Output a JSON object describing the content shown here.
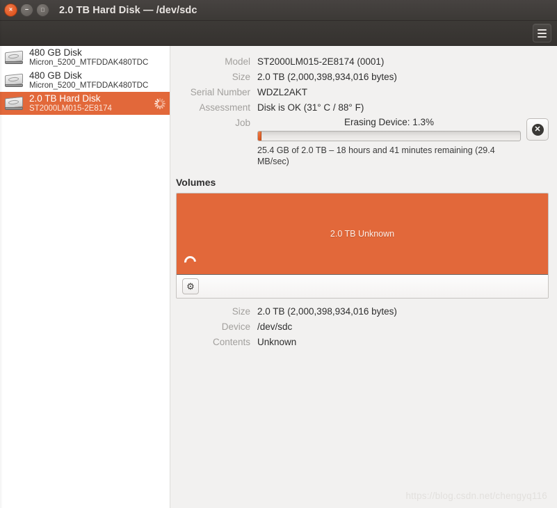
{
  "window": {
    "title": "2.0 TB Hard Disk — /dev/sdc",
    "close_glyph": "×",
    "minimize_glyph": "−",
    "maximize_glyph": "□"
  },
  "toolbar": {
    "menu_button_name": "Main Menu"
  },
  "sidebar": {
    "disks": [
      {
        "title": "480 GB Disk",
        "subtitle": "Micron_5200_MTFDDAK480TDC",
        "selected": false,
        "busy": false
      },
      {
        "title": "480 GB Disk",
        "subtitle": "Micron_5200_MTFDDAK480TDC",
        "selected": false,
        "busy": false
      },
      {
        "title": "2.0 TB Hard Disk",
        "subtitle": "ST2000LM015-2E8174",
        "selected": true,
        "busy": true
      }
    ]
  },
  "drive": {
    "fields": [
      {
        "label": "Model",
        "value": "ST2000LM015-2E8174 (0001)"
      },
      {
        "label": "Size",
        "value": "2.0 TB (2,000,398,934,016 bytes)"
      },
      {
        "label": "Serial Number",
        "value": "WDZL2AKT"
      },
      {
        "label": "Assessment",
        "value": "Disk is OK (31° C / 88° F)"
      }
    ],
    "job": {
      "label": "Job",
      "caption": "Erasing Device: 1.3%",
      "percent": 1.3,
      "detail": "25.4 GB of 2.0 TB – 18 hours and 41 minutes remaining (29.4 MB/sec)",
      "cancel_glyph": "✖"
    }
  },
  "volumes": {
    "heading": "Volumes",
    "partition_label": "2.0 TB Unknown",
    "partition_color": "#e2683a",
    "gear_glyph": "⚙",
    "fields": [
      {
        "label": "Size",
        "value": "2.0 TB (2,000,398,934,016 bytes)"
      },
      {
        "label": "Device",
        "value": "/dev/sdc"
      },
      {
        "label": "Contents",
        "value": "Unknown"
      }
    ]
  },
  "watermark": {
    "text": "https://blog.csdn.net/chengyq116"
  }
}
